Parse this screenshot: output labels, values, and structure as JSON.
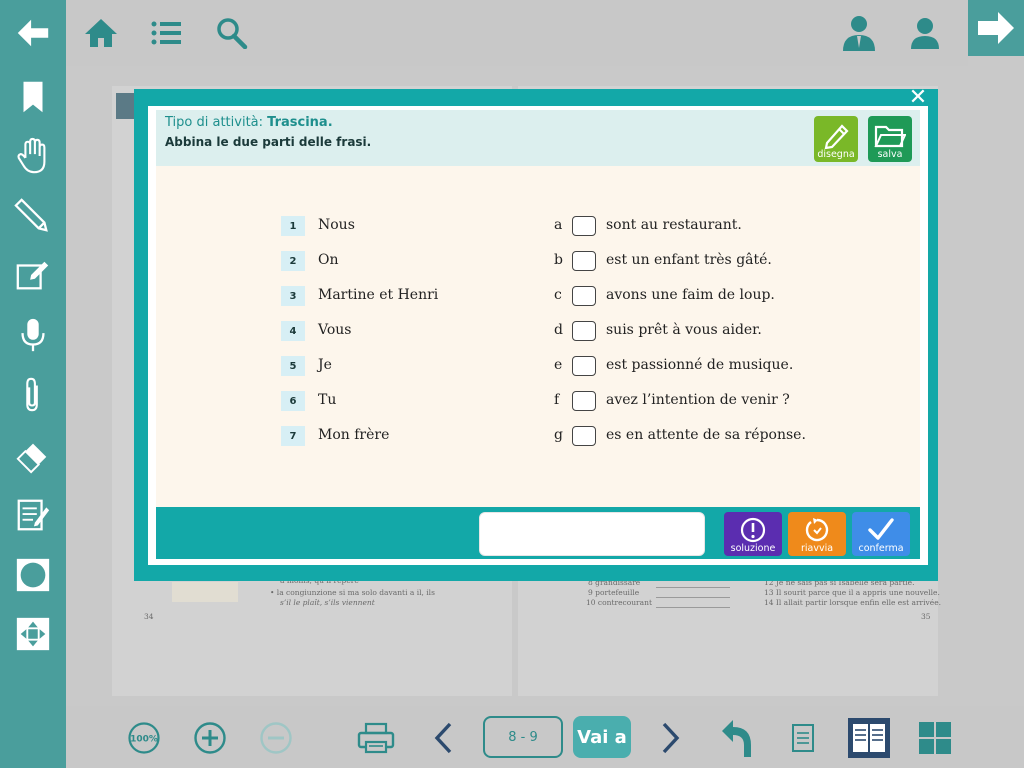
{
  "colors": {
    "sidebar": "#4a9e9c",
    "modal_frame": "#13a8a8",
    "disegna": "#7ab828",
    "salva": "#1f9a57",
    "soluzione": "#5b2db0",
    "riavvia": "#ef8a1b",
    "conferma": "#3f8de8"
  },
  "icons": {
    "back": "back-arrow-icon",
    "home": "home-icon",
    "list": "list-icon",
    "search": "search-icon",
    "teacher": "teacher-icon",
    "user": "user-icon",
    "next": "forward-arrow-icon"
  },
  "activity": {
    "type_label": "Tipo di attività: ",
    "type_value": "Trascina.",
    "instruction": "Abbina le due parti delle frasi.",
    "buttons": {
      "disegna": "disegna",
      "salva": "salva"
    },
    "left_items": [
      {
        "num": "1",
        "text": "Nous"
      },
      {
        "num": "2",
        "text": "On"
      },
      {
        "num": "3",
        "text": "Martine et Henri"
      },
      {
        "num": "4",
        "text": "Vous"
      },
      {
        "num": "5",
        "text": "Je"
      },
      {
        "num": "6",
        "text": "Tu"
      },
      {
        "num": "7",
        "text": "Mon frère"
      }
    ],
    "right_items": [
      {
        "letter": "a",
        "text": "sont au restaurant."
      },
      {
        "letter": "b",
        "text": "est un enfant très gâté."
      },
      {
        "letter": "c",
        "text": "avons une faim de loup."
      },
      {
        "letter": "d",
        "text": "suis prêt à vous aider."
      },
      {
        "letter": "e",
        "text": "est passionné de musique."
      },
      {
        "letter": "f",
        "text": "avez l’intention de venir ?"
      },
      {
        "letter": "g",
        "text": "es en attente de sa réponse."
      }
    ],
    "footer": {
      "input_value": "",
      "soluzione": "soluzione",
      "riavvia": "riavvia",
      "conferma": "conferma"
    }
  },
  "book": {
    "left_lines": [
      "à moins, qu’il repère",
      "• la congiunzione si ma solo davanti a il, ils",
      "s’il le plaît, s’ils viennent"
    ],
    "left_page_num": "34",
    "right_lines_a": [
      "8  grandissare",
      "9  portefeuille",
      "10  contrecourant"
    ],
    "right_lines_b": [
      "12  Je ne sais pas si Isabelle sera partie.",
      "13  Il sourit parce que il a appris une nouvelle.",
      "14  Il allait partir lorsque enfin elle est arrivée."
    ],
    "right_page_num": "35"
  },
  "navigation": {
    "zoom": "100%",
    "page_range": "8 - 9",
    "go_label": "Vai a"
  }
}
